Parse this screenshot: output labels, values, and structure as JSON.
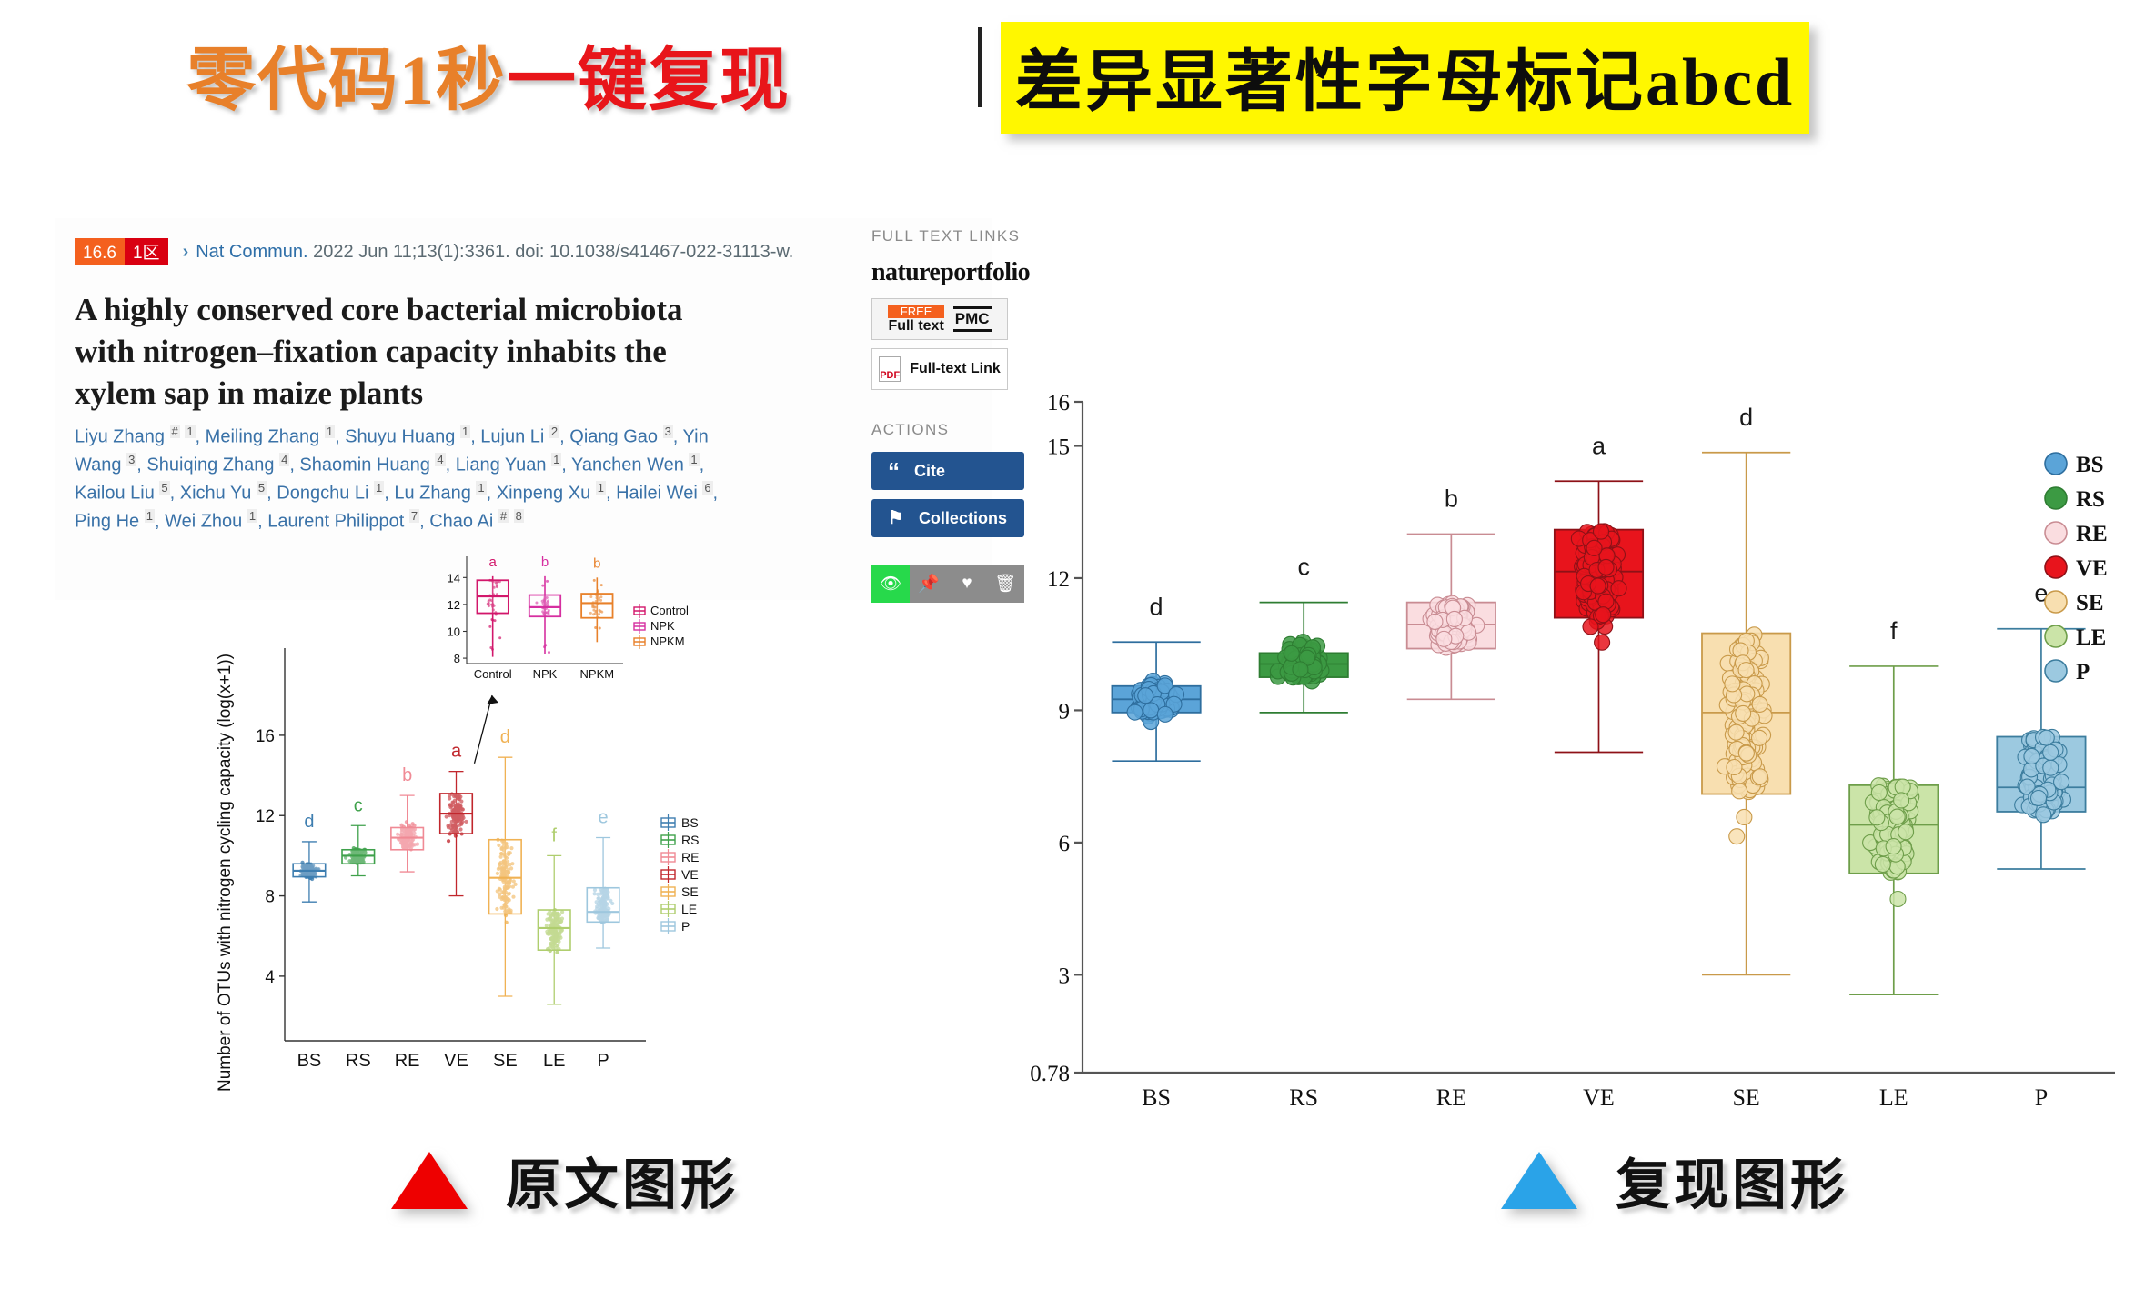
{
  "banner": {
    "left_text_1": "零代码1秒",
    "left_text_red": "一键复现",
    "divider": "|",
    "right_text": "差异显著性字母标记abcd"
  },
  "pubmed": {
    "badge_impact": "16.6",
    "badge_zone": "1区",
    "chevron": "›",
    "journal": "Nat Commun.",
    "citation": " 2022 Jun 11;13(1):3361. doi: 10.1038/s41467-022-31113-w.",
    "title": "A highly conserved core bacterial microbiota with nitrogen–fixation capacity inhabits the xylem sap in maize plants",
    "authors_html": "Liyu Zhang <sup>#</sup> <sup>1</sup>, Meiling Zhang <sup>1</sup>, Shuyu Huang <sup>1</sup>, Lujun Li <sup>2</sup>, Qiang Gao <sup>3</sup>, Yin Wang <sup>3</sup>, Shuiqing Zhang <sup>4</sup>, Shaomin Huang <sup>4</sup>, Liang Yuan <sup>1</sup>, Yanchen Wen <sup>1</sup>, Kailou Liu <sup>5</sup>, Xichu Yu <sup>5</sup>, Dongchu Li <sup>1</sup>, Lu Zhang <sup>1</sup>, Xinpeng Xu <sup>1</sup>, Hailei Wei <sup>6</sup>, Ping He <sup>1</sup>, Wei Zhou <sup>1</sup>, Laurent Philippot <sup>7</sup>, Chao Ai <sup>#</sup> <sup>8</sup>"
  },
  "sidebar": {
    "full_text_links_header": "FULL TEXT LINKS",
    "nature_logo": "natureportfolio",
    "free_tag": "FREE",
    "full_text_label": "Full text",
    "pmc_label": "PMC",
    "pdf_icon_label": "PDF",
    "full_text_link_label": "Full-text Link",
    "actions_header": "ACTIONS",
    "cite_label": "Cite",
    "cite_icon": "“",
    "collections_label": "Collections",
    "collections_icon": "⚑",
    "tool_icons": [
      "eye-icon",
      "pin-icon",
      "heart-icon",
      "trash-icon"
    ],
    "tool_glyphs": [
      "◉",
      "✔",
      "♥",
      "Ὕ1"
    ]
  },
  "captions": {
    "original": {
      "label": "原文图形",
      "triangle_color": "#EE0000"
    },
    "reproduced": {
      "label": "复现图形",
      "triangle_color": "#2AA3E8"
    }
  },
  "chart_data": [
    {
      "id": "original-figure",
      "type": "box",
      "title": "",
      "xlabel": "",
      "ylabel": "Number of OTUs with nitrogen cycling capacity (log(x+1))",
      "categories": [
        "BS",
        "RS",
        "RE",
        "VE",
        "SE",
        "LE",
        "P"
      ],
      "ytick_labels": [
        "4",
        "8",
        "12",
        "16"
      ],
      "ytick_values": [
        4,
        8,
        12,
        16
      ],
      "ylim": [
        0.78,
        17.4
      ],
      "grid": false,
      "legend_position": "right",
      "legend_entries": [
        "BS",
        "RS",
        "RE",
        "VE",
        "SE",
        "LE",
        "P"
      ],
      "significance_letters": [
        "d",
        "c",
        "b",
        "a",
        "d",
        "f",
        "e"
      ],
      "colors": {
        "BS": "#3E7EB0",
        "RS": "#3FA14B",
        "RE": "#F08A95",
        "VE": "#C1272D",
        "SE": "#F0B254",
        "LE": "#AFCE6E",
        "P": "#9EC7DE"
      },
      "fills": {
        "BS": "#ffffff",
        "RS": "#ffffff",
        "RE": "#ffffff",
        "VE": "#ffffff",
        "SE": "#ffffff",
        "LE": "#ffffff",
        "P": "#ffffff"
      },
      "boxes": [
        {
          "name": "BS",
          "min": 7.7,
          "q1": 8.95,
          "median": 9.25,
          "q3": 9.6,
          "max": 10.7
        },
        {
          "name": "RS",
          "min": 9.0,
          "q1": 9.6,
          "median": 10.0,
          "q3": 10.3,
          "max": 11.5
        },
        {
          "name": "RE",
          "min": 9.2,
          "q1": 10.3,
          "median": 10.9,
          "q3": 11.4,
          "max": 13.0
        },
        {
          "name": "VE",
          "min": 8.0,
          "q1": 11.1,
          "median": 12.1,
          "q3": 13.1,
          "max": 14.2
        },
        {
          "name": "SE",
          "min": 3.0,
          "q1": 7.1,
          "median": 8.9,
          "q3": 10.8,
          "max": 14.9
        },
        {
          "name": "LE",
          "min": 2.6,
          "q1": 5.3,
          "median": 6.4,
          "q3": 7.3,
          "max": 10.0
        },
        {
          "name": "P",
          "min": 5.4,
          "q1": 6.7,
          "median": 7.2,
          "q3": 8.4,
          "max": 10.9
        }
      ]
    },
    {
      "id": "original-inset",
      "type": "box",
      "title": "",
      "categories": [
        "Control",
        "NPK",
        "NPKM"
      ],
      "ytick_labels": [
        "8",
        "10",
        "12",
        "14"
      ],
      "ytick_values": [
        8,
        10,
        12,
        14
      ],
      "ylim": [
        7.6,
        14.9
      ],
      "legend_position": "right",
      "legend_entries": [
        "Control",
        "NPK",
        "NPKM"
      ],
      "significance_letters": [
        "a",
        "b",
        "b"
      ],
      "colors": {
        "Control": "#D2176B",
        "NPK": "#D62FA0",
        "NPKM": "#E8812A"
      },
      "boxes": [
        {
          "name": "Control",
          "min": 8.1,
          "q1": 11.35,
          "median": 12.6,
          "q3": 13.8,
          "max": 14.1
        },
        {
          "name": "NPK",
          "min": 8.3,
          "q1": 11.1,
          "median": 11.8,
          "q3": 12.7,
          "max": 14.1
        },
        {
          "name": "NPKM",
          "min": 9.2,
          "q1": 11.0,
          "median": 12.1,
          "q3": 12.8,
          "max": 14.0
        }
      ]
    },
    {
      "id": "reproduced-figure",
      "type": "box",
      "title": "",
      "xlabel": "",
      "ylabel": "",
      "categories": [
        "BS",
        "RS",
        "RE",
        "VE",
        "SE",
        "LE",
        "P"
      ],
      "ytick_labels": [
        "0.78",
        "3",
        "6",
        "9",
        "12",
        "15",
        "16"
      ],
      "ytick_values": [
        0.78,
        3,
        6,
        9,
        12,
        15,
        16
      ],
      "ylim": [
        0.78,
        16
      ],
      "grid": false,
      "legend_position": "right",
      "legend_entries": [
        "BS",
        "RS",
        "RE",
        "VE",
        "SE",
        "LE",
        "P"
      ],
      "significance_letters": [
        "d",
        "c",
        "b",
        "a",
        "d",
        "f",
        "e"
      ],
      "colors": {
        "BS": "#2E6E9E",
        "RS": "#2E7D32",
        "RE": "#C98C93",
        "VE": "#8E1117",
        "SE": "#C99A4A",
        "LE": "#6E9E4A",
        "P": "#3C7D9E"
      },
      "fills": {
        "BS": "#5BA4D8",
        "RS": "#3C9A43",
        "RE": "#FADDE0",
        "VE": "#E8141C",
        "SE": "#F8DFB0",
        "LE": "#CBE4A8",
        "P": "#9CC9E0"
      },
      "boxes": [
        {
          "name": "BS",
          "min": 7.85,
          "q1": 8.95,
          "median": 9.25,
          "q3": 9.55,
          "max": 10.55
        },
        {
          "name": "RS",
          "min": 8.95,
          "q1": 9.75,
          "median": 10.05,
          "q3": 10.3,
          "max": 11.45
        },
        {
          "name": "RE",
          "min": 9.25,
          "q1": 10.4,
          "median": 10.95,
          "q3": 11.45,
          "max": 13.0
        },
        {
          "name": "VE",
          "min": 8.05,
          "q1": 11.1,
          "median": 12.15,
          "q3": 13.1,
          "max": 14.2
        },
        {
          "name": "SE",
          "min": 3.0,
          "q1": 7.1,
          "median": 8.95,
          "q3": 10.75,
          "max": 14.85
        },
        {
          "name": "LE",
          "min": 2.55,
          "q1": 5.3,
          "median": 6.4,
          "q3": 7.3,
          "max": 10.0
        },
        {
          "name": "P",
          "min": 5.4,
          "q1": 6.7,
          "median": 7.25,
          "q3": 8.4,
          "max": 10.85
        }
      ]
    }
  ]
}
